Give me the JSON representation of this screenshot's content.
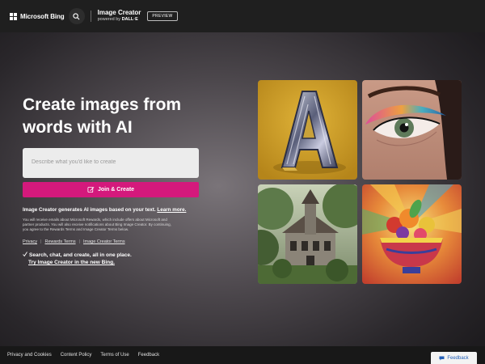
{
  "header": {
    "brand_name": "Microsoft Bing",
    "app_title": "Image Creator",
    "powered_by": "powered by",
    "powered_by_model": "DALL·E",
    "preview_badge": "PREVIEW"
  },
  "hero": {
    "title": "Create images from words with AI",
    "prompt_placeholder": "Describe what you'd like to create",
    "join_button": "Join & Create",
    "generation_note": "Image Creator generates AI images based on your text.",
    "learn_more": "Learn more.",
    "fine_print": "You will receive emails about Microsoft Rewards, which include offers about Microsoft and partner products. You will also receive notifications about Bing Image Creator. By continuing, you agree to the Rewards Terms and Image Creator Terms below.",
    "links": [
      "Privacy",
      "Rewards Terms",
      "Image Creator Terms"
    ],
    "promo_line1": "Search, chat, and create, all in one place.",
    "promo_line2": "Try Image Creator in the new Bing."
  },
  "gallery": {
    "images": [
      "letter-a-sculpture",
      "colorful-eye-makeup",
      "overgrown-victorian-house",
      "fruit-bowl-explosion"
    ]
  },
  "footer": {
    "links": [
      "Privacy and Cookies",
      "Content Policy",
      "Terms of Use",
      "Feedback"
    ],
    "feedback_button": "Feedback"
  },
  "colors": {
    "accent": "#d4197c",
    "header_bg": "#1f1f1f",
    "footer_bg": "#181818",
    "feedback_text": "#2460b8"
  },
  "icons": {
    "logo": "microsoft-logo-icon",
    "search": "search-icon",
    "join": "pen-sparkle-icon",
    "promo": "check-sparkle-icon",
    "feedback": "feedback-icon"
  }
}
